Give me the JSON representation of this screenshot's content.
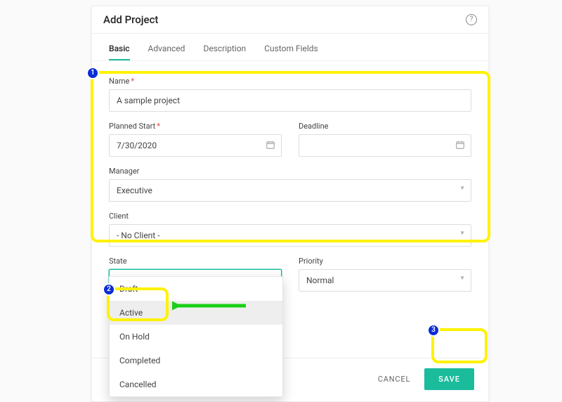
{
  "header": {
    "title": "Add Project"
  },
  "tabs": {
    "items": [
      {
        "label": "Basic"
      },
      {
        "label": "Advanced"
      },
      {
        "label": "Description"
      },
      {
        "label": "Custom Fields"
      }
    ]
  },
  "form": {
    "name": {
      "label": "Name",
      "value": "A sample project"
    },
    "planned_start": {
      "label": "Planned Start",
      "value": "7/30/2020"
    },
    "deadline": {
      "label": "Deadline",
      "value": ""
    },
    "manager": {
      "label": "Manager",
      "value": "Executive"
    },
    "client": {
      "label": "Client",
      "value": "- No Client -"
    },
    "state": {
      "label": "State",
      "value": "Active"
    },
    "priority": {
      "label": "Priority",
      "value": "Normal"
    }
  },
  "state_dropdown": {
    "items": [
      {
        "label": "Draft"
      },
      {
        "label": "Active"
      },
      {
        "label": "On Hold"
      },
      {
        "label": "Completed"
      },
      {
        "label": "Cancelled"
      }
    ]
  },
  "footer": {
    "cancel": "CANCEL",
    "save": "SAVE"
  },
  "annotations": {
    "a1": "1",
    "a2": "2",
    "a3": "3"
  }
}
